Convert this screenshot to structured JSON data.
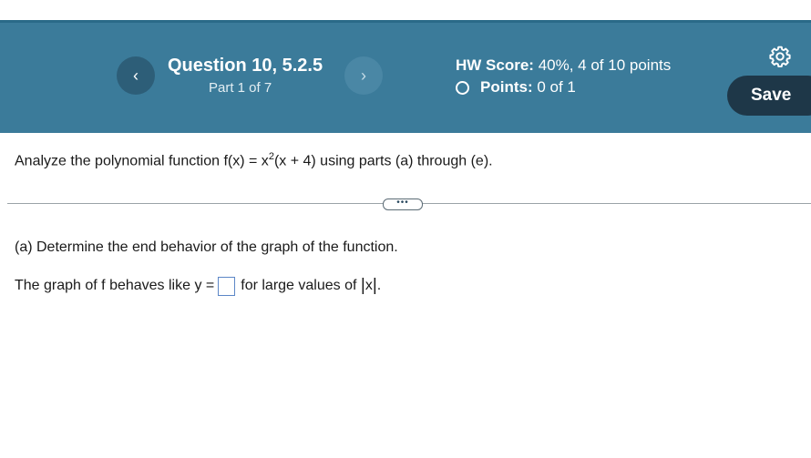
{
  "header": {
    "prev_icon": "chevron-left-icon",
    "next_icon": "chevron-right-icon",
    "question_title": "Question 10, 5.2.5",
    "part": "Part 1 of 7",
    "hw_score_label": "HW Score:",
    "hw_score_value": "40%, 4 of 10 points",
    "points_label": "Points:",
    "points_value": "0 of 1",
    "settings_icon": "gear-icon",
    "save_label": "Save",
    "colors": {
      "header_bg": "#3b7b9a",
      "save_bg": "#1e3748"
    }
  },
  "content": {
    "prompt_before": "Analyze the polynomial function f(x) = x",
    "prompt_exponent": "2",
    "prompt_after": "(x + 4) using parts (a) through (e).",
    "more_label": "•••",
    "part_a": "(a) Determine the end behavior of the graph of the function.",
    "answer_before": "The graph of f behaves like y =",
    "answer_value": "",
    "answer_after_1": "for large values of",
    "answer_abs_left": "|",
    "answer_x": "x",
    "answer_abs_right": "|",
    "answer_period": "."
  }
}
